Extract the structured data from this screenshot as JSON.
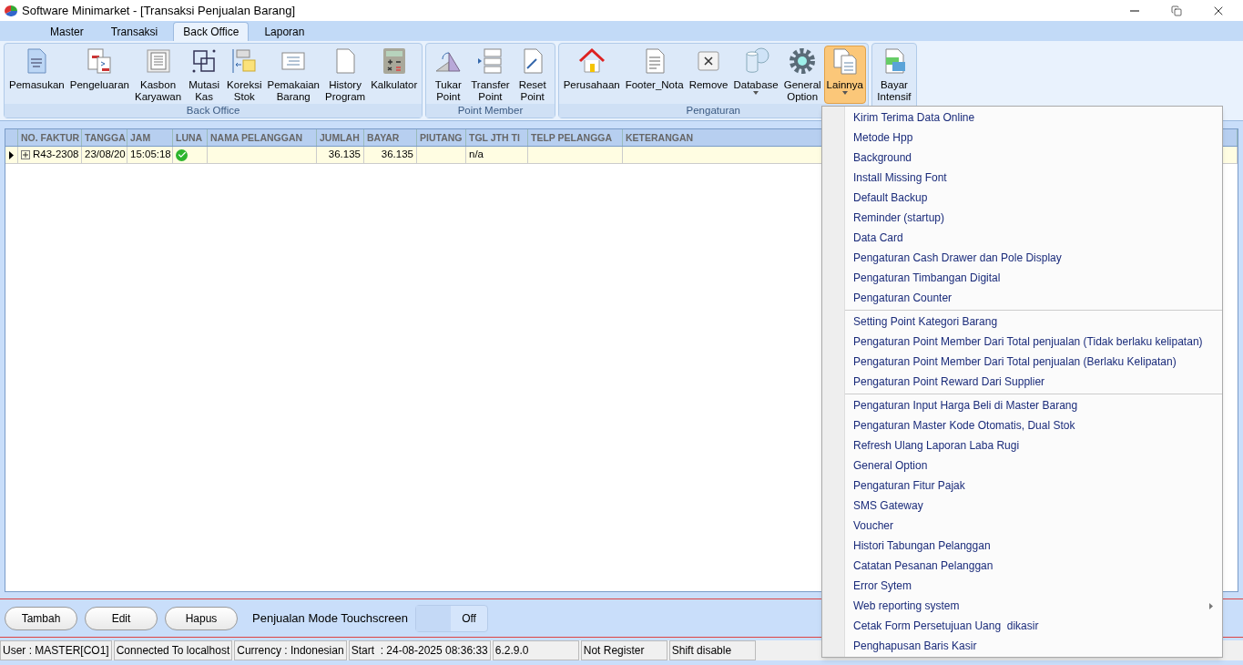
{
  "window": {
    "title": "Software Minimarket - [Transaksi Penjualan Barang]"
  },
  "tabs": [
    {
      "label": "Master",
      "selected": false
    },
    {
      "label": "Transaksi",
      "selected": false
    },
    {
      "label": "Back Office",
      "selected": true
    },
    {
      "label": "Laporan",
      "selected": false
    }
  ],
  "ribbon_groups": [
    {
      "label": "Back Office",
      "buttons": [
        {
          "label": "Pemasukan",
          "selected": false,
          "dropdown": false
        },
        {
          "label": "Pengeluaran",
          "selected": false,
          "dropdown": false
        },
        {
          "label": "Kasbon\nKaryawan",
          "selected": false,
          "dropdown": false
        },
        {
          "label": "Mutasi\nKas",
          "selected": false,
          "dropdown": false
        },
        {
          "label": "Koreksi\nStok",
          "selected": false,
          "dropdown": false
        },
        {
          "label": "Pemakaian\nBarang",
          "selected": false,
          "dropdown": false
        },
        {
          "label": "History\nProgram",
          "selected": false,
          "dropdown": false
        },
        {
          "label": "Kalkulator",
          "selected": false,
          "dropdown": false
        }
      ]
    },
    {
      "label": "Point Member",
      "buttons": [
        {
          "label": "Tukar\nPoint",
          "selected": false,
          "dropdown": false
        },
        {
          "label": "Transfer\nPoint",
          "selected": false,
          "dropdown": false
        },
        {
          "label": "Reset\nPoint",
          "selected": false,
          "dropdown": false
        }
      ]
    },
    {
      "label": "Pengaturan",
      "buttons": [
        {
          "label": "Perusahaan",
          "selected": false,
          "dropdown": false
        },
        {
          "label": "Footer_Nota",
          "selected": false,
          "dropdown": false
        },
        {
          "label": "Remove",
          "selected": false,
          "dropdown": false
        },
        {
          "label": "Database",
          "selected": false,
          "dropdown": true
        },
        {
          "label": "General\nOption",
          "selected": false,
          "dropdown": false
        },
        {
          "label": "Lainnya",
          "selected": true,
          "dropdown": true
        }
      ]
    },
    {
      "buttons": [
        {
          "label": "Bayar\nIntensif",
          "selected": false,
          "dropdown": false
        }
      ]
    }
  ],
  "table": {
    "columns": [
      "NO. FAKTUR",
      "TANGGA",
      "JAM",
      "LUNA",
      "NAMA PELANGGAN",
      "JUMLAH",
      "BAYAR",
      "PIUTANG",
      "TGL JTH TI",
      "TELP PELANGGA",
      "KETERANGAN"
    ],
    "rows": [
      {
        "selected": true,
        "expanded": false,
        "paid": true,
        "cells": [
          "R43-2308",
          "23/08/20",
          "15:05:18",
          "",
          "",
          "36.135",
          "36.135",
          "",
          "n/a",
          "",
          ""
        ]
      }
    ]
  },
  "bottom_bar": {
    "buttons": [
      "Tambah",
      "Edit",
      "Hapus"
    ],
    "toggle": {
      "label": "Penjualan Mode Touchscreen",
      "on": false,
      "state_text": "Off"
    }
  },
  "status_bar": [
    "User : MASTER[CO1]",
    "Connected To localhost",
    "Currency : Indonesian",
    "Start  : 24-08-2025 08:36:33",
    "6.2.9.0",
    "Not Register",
    "Shift disable"
  ],
  "menu": {
    "groups": [
      [
        {
          "label": "Kirim Terima Data Online",
          "submenu": false
        },
        {
          "label": "Metode Hpp",
          "submenu": false
        },
        {
          "label": "Background",
          "submenu": false
        },
        {
          "label": "Install Missing Font",
          "submenu": false
        },
        {
          "label": "Default Backup",
          "submenu": false
        },
        {
          "label": "Reminder (startup)",
          "submenu": false
        },
        {
          "label": "Data Card",
          "submenu": false
        },
        {
          "label": "Pengaturan Cash Drawer dan Pole Display",
          "submenu": false
        },
        {
          "label": "Pengaturan Timbangan Digital",
          "submenu": false
        },
        {
          "label": "Pengaturan Counter",
          "submenu": false
        }
      ],
      [
        {
          "label": "Setting Point Kategori Barang",
          "submenu": false
        },
        {
          "label": "Pengaturan Point Member Dari Total penjualan (Tidak berlaku kelipatan)",
          "submenu": false
        },
        {
          "label": "Pengaturan Point Member Dari Total penjualan (Berlaku Kelipatan)",
          "submenu": false
        },
        {
          "label": "Pengaturan Point Reward Dari Supplier",
          "submenu": false
        }
      ],
      [
        {
          "label": "Pengaturan Input Harga Beli di Master Barang",
          "submenu": false
        },
        {
          "label": "Pengaturan Master Kode Otomatis, Dual Stok",
          "submenu": false
        },
        {
          "label": "Refresh Ulang Laporan Laba Rugi",
          "submenu": false
        },
        {
          "label": "General Option",
          "submenu": false
        },
        {
          "label": "Pengaturan Fitur Pajak",
          "submenu": false
        },
        {
          "label": "SMS Gateway",
          "submenu": false
        },
        {
          "label": "Voucher",
          "submenu": false
        },
        {
          "label": "Histori Tabungan Pelanggan",
          "submenu": false
        },
        {
          "label": "Catatan Pesanan Pelanggan",
          "submenu": false
        },
        {
          "label": "Error Sytem",
          "submenu": false
        },
        {
          "label": "Web reporting system",
          "submenu": true
        },
        {
          "label": "Cetak Form Persetujuan Uang  dikasir",
          "submenu": false
        },
        {
          "label": "Penghapusan Baris Kasir",
          "submenu": false
        }
      ]
    ]
  }
}
